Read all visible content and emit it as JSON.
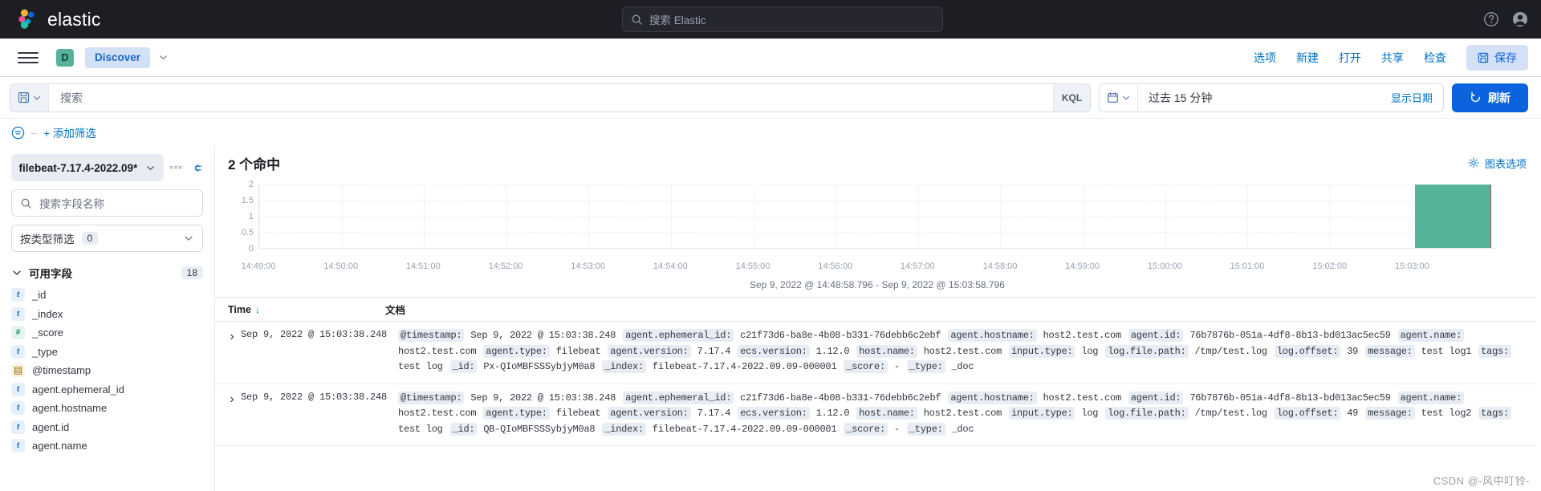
{
  "topbar": {
    "brand": "elastic",
    "search_placeholder": "搜索 Elastic",
    "icons": [
      "help-icon",
      "avatar-icon"
    ]
  },
  "navbar": {
    "app_initial": "D",
    "breadcrumb": "Discover",
    "links": [
      "选项",
      "新建",
      "打开",
      "共享",
      "检查"
    ],
    "save_label": "保存"
  },
  "querybar": {
    "query_placeholder": "搜索",
    "query_language": "KQL",
    "time_range": "过去 15 分钟",
    "show_dates": "显示日期",
    "refresh_label": "刷新"
  },
  "filterbar": {
    "add_filter": "+ 添加筛选"
  },
  "sidebar": {
    "index_pattern": "filebeat-7.17.4-2022.09*",
    "field_search_placeholder": "搜索字段名称",
    "type_filter_label": "按类型筛选",
    "type_filter_count": "0",
    "available_fields_label": "可用字段",
    "available_fields_count": "18",
    "fields": [
      {
        "name": "_id",
        "type": "t"
      },
      {
        "name": "_index",
        "type": "t"
      },
      {
        "name": "_score",
        "type": "num"
      },
      {
        "name": "_type",
        "type": "t"
      },
      {
        "name": "@timestamp",
        "type": "date"
      },
      {
        "name": "agent.ephemeral_id",
        "type": "t"
      },
      {
        "name": "agent.hostname",
        "type": "t"
      },
      {
        "name": "agent.id",
        "type": "t"
      },
      {
        "name": "agent.name",
        "type": "t"
      }
    ]
  },
  "main": {
    "hits_label": "2 个命中",
    "chart_options_label": "图表选项",
    "chart_caption": "Sep 9, 2022 @ 14:48:58.796 - Sep 9, 2022 @ 15:03:58.796",
    "columns": {
      "time": "Time",
      "document": "文档"
    }
  },
  "chart_data": {
    "type": "bar",
    "title": "",
    "xlabel": "",
    "ylabel": "",
    "ylim": [
      0,
      2
    ],
    "yticks": [
      "2",
      "1.5",
      "1",
      "0.5",
      "0"
    ],
    "categories": [
      "14:49:00",
      "14:50:00",
      "14:51:00",
      "14:52:00",
      "14:53:00",
      "14:54:00",
      "14:55:00",
      "14:56:00",
      "14:57:00",
      "14:58:00",
      "14:59:00",
      "15:00:00",
      "15:01:00",
      "15:02:00",
      "15:03:00"
    ],
    "values": [
      0,
      0,
      0,
      0,
      0,
      0,
      0,
      0,
      0,
      0,
      0,
      0,
      0,
      0,
      2
    ],
    "bar_color": "#54B399",
    "grid": true,
    "legend": "none"
  },
  "documents": [
    {
      "time": "Sep 9, 2022 @ 15:03:38.248",
      "fields": [
        {
          "k": "@timestamp:",
          "v": "Sep 9, 2022 @ 15:03:38.248"
        },
        {
          "k": "agent.ephemeral_id:",
          "v": "c21f73d6-ba8e-4b08-b331-76debb6c2ebf"
        },
        {
          "k": "agent.hostname:",
          "v": "host2.test.com"
        },
        {
          "k": "agent.id:",
          "v": "76b7876b-051a-4df8-8b13-bd013ac5ec59"
        },
        {
          "k": "agent.name:",
          "v": "host2.test.com"
        },
        {
          "k": "agent.type:",
          "v": "filebeat"
        },
        {
          "k": "agent.version:",
          "v": "7.17.4"
        },
        {
          "k": "ecs.version:",
          "v": "1.12.0"
        },
        {
          "k": "host.name:",
          "v": "host2.test.com"
        },
        {
          "k": "input.type:",
          "v": "log"
        },
        {
          "k": "log.file.path:",
          "v": "/tmp/test.log"
        },
        {
          "k": "log.offset:",
          "v": "39"
        },
        {
          "k": "message:",
          "v": "test log1"
        },
        {
          "k": "tags:",
          "v": "test log"
        },
        {
          "k": "_id:",
          "v": "Px-QIoMBFSSSybjyM0a8"
        },
        {
          "k": "_index:",
          "v": "filebeat-7.17.4-2022.09.09-000001"
        },
        {
          "k": "_score:",
          "v": "-"
        },
        {
          "k": "_type:",
          "v": "_doc"
        }
      ]
    },
    {
      "time": "Sep 9, 2022 @ 15:03:38.248",
      "fields": [
        {
          "k": "@timestamp:",
          "v": "Sep 9, 2022 @ 15:03:38.248"
        },
        {
          "k": "agent.ephemeral_id:",
          "v": "c21f73d6-ba8e-4b08-b331-76debb6c2ebf"
        },
        {
          "k": "agent.hostname:",
          "v": "host2.test.com"
        },
        {
          "k": "agent.id:",
          "v": "76b7876b-051a-4df8-8b13-bd013ac5ec59"
        },
        {
          "k": "agent.name:",
          "v": "host2.test.com"
        },
        {
          "k": "agent.type:",
          "v": "filebeat"
        },
        {
          "k": "agent.version:",
          "v": "7.17.4"
        },
        {
          "k": "ecs.version:",
          "v": "1.12.0"
        },
        {
          "k": "host.name:",
          "v": "host2.test.com"
        },
        {
          "k": "input.type:",
          "v": "log"
        },
        {
          "k": "log.file.path:",
          "v": "/tmp/test.log"
        },
        {
          "k": "log.offset:",
          "v": "49"
        },
        {
          "k": "message:",
          "v": "test log2"
        },
        {
          "k": "tags:",
          "v": "test log"
        },
        {
          "k": "_id:",
          "v": "QB-QIoMBFSSSybjyM0a8"
        },
        {
          "k": "_index:",
          "v": "filebeat-7.17.4-2022.09.09-000001"
        },
        {
          "k": "_score:",
          "v": "-"
        },
        {
          "k": "_type:",
          "v": "_doc"
        }
      ]
    }
  ],
  "watermark": "CSDN @-风中叮铃-"
}
